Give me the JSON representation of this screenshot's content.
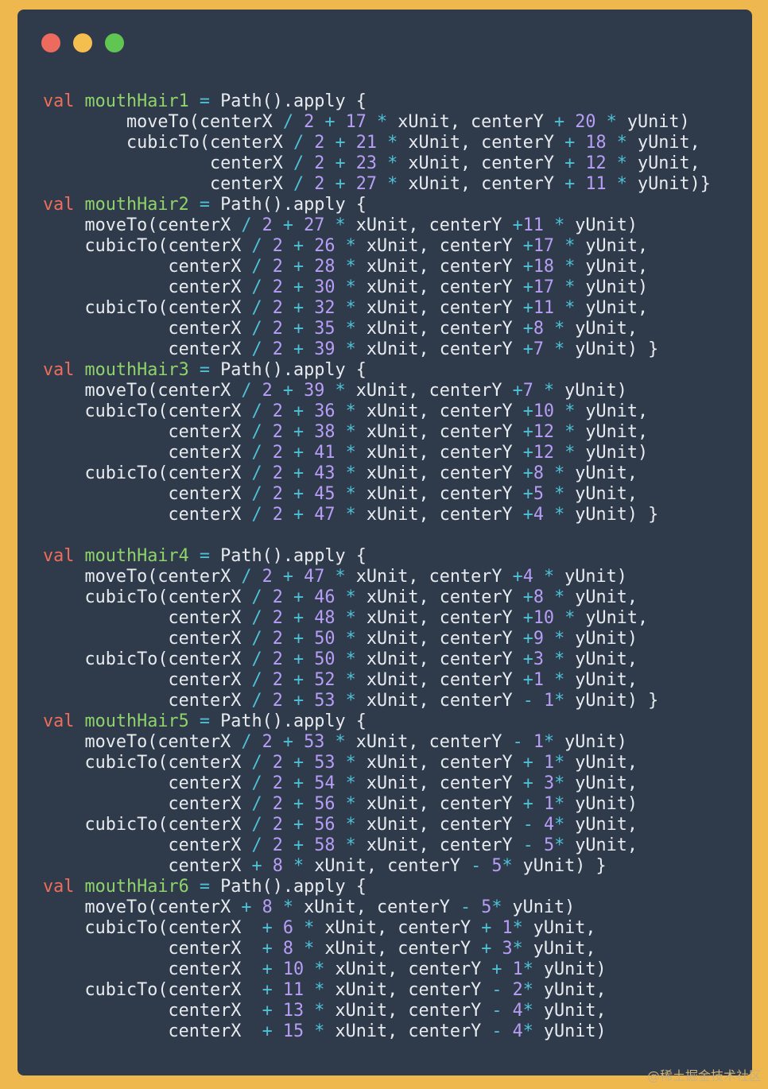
{
  "window": {
    "controls": [
      {
        "name": "close",
        "color": "#ed6a5e"
      },
      {
        "name": "minimize",
        "color": "#f5bf4f"
      },
      {
        "name": "maximize",
        "color": "#61c554"
      }
    ]
  },
  "colors": {
    "background": "#eeb84e",
    "editor": "#2f3a4b",
    "keyword": "#ef6e5b",
    "identifier": "#8fd36b",
    "number": "#b89ef5",
    "operator": "#4fc1d6",
    "text": "#e8ebef"
  },
  "code_lines": [
    "val mouthHair1 = Path().apply {",
    "        moveTo(centerX / 2 + 17 * xUnit, centerY + 20 * yUnit)",
    "        cubicTo(centerX / 2 + 21 * xUnit, centerY + 18 * yUnit,",
    "                centerX / 2 + 23 * xUnit, centerY + 12 * yUnit,",
    "                centerX / 2 + 27 * xUnit, centerY + 11 * yUnit)}",
    "val mouthHair2 = Path().apply {",
    "    moveTo(centerX / 2 + 27 * xUnit, centerY +11 * yUnit)",
    "    cubicTo(centerX / 2 + 26 * xUnit, centerY +17 * yUnit,",
    "            centerX / 2 + 28 * xUnit, centerY +18 * yUnit,",
    "            centerX / 2 + 30 * xUnit, centerY +17 * yUnit)",
    "    cubicTo(centerX / 2 + 32 * xUnit, centerY +11 * yUnit,",
    "            centerX / 2 + 35 * xUnit, centerY +8 * yUnit,",
    "            centerX / 2 + 39 * xUnit, centerY +7 * yUnit) }",
    "val mouthHair3 = Path().apply {",
    "    moveTo(centerX / 2 + 39 * xUnit, centerY +7 * yUnit)",
    "    cubicTo(centerX / 2 + 36 * xUnit, centerY +10 * yUnit,",
    "            centerX / 2 + 38 * xUnit, centerY +12 * yUnit,",
    "            centerX / 2 + 41 * xUnit, centerY +12 * yUnit)",
    "    cubicTo(centerX / 2 + 43 * xUnit, centerY +8 * yUnit,",
    "            centerX / 2 + 45 * xUnit, centerY +5 * yUnit,",
    "            centerX / 2 + 47 * xUnit, centerY +4 * yUnit) }",
    "",
    "val mouthHair4 = Path().apply {",
    "    moveTo(centerX / 2 + 47 * xUnit, centerY +4 * yUnit)",
    "    cubicTo(centerX / 2 + 46 * xUnit, centerY +8 * yUnit,",
    "            centerX / 2 + 48 * xUnit, centerY +10 * yUnit,",
    "            centerX / 2 + 50 * xUnit, centerY +9 * yUnit)",
    "    cubicTo(centerX / 2 + 50 * xUnit, centerY +3 * yUnit,",
    "            centerX / 2 + 52 * xUnit, centerY +1 * yUnit,",
    "            centerX / 2 + 53 * xUnit, centerY - 1* yUnit) }",
    "val mouthHair5 = Path().apply {",
    "    moveTo(centerX / 2 + 53 * xUnit, centerY - 1* yUnit)",
    "    cubicTo(centerX / 2 + 53 * xUnit, centerY + 1* yUnit,",
    "            centerX / 2 + 54 * xUnit, centerY + 3* yUnit,",
    "            centerX / 2 + 56 * xUnit, centerY + 1* yUnit)",
    "    cubicTo(centerX / 2 + 56 * xUnit, centerY - 4* yUnit,",
    "            centerX / 2 + 58 * xUnit, centerY - 5* yUnit,",
    "            centerX + 8 * xUnit, centerY - 5* yUnit) }",
    "val mouthHair6 = Path().apply {",
    "    moveTo(centerX + 8 * xUnit, centerY - 5* yUnit)",
    "    cubicTo(centerX  + 6 * xUnit, centerY + 1* yUnit,",
    "            centerX  + 8 * xUnit, centerY + 3* yUnit,",
    "            centerX  + 10 * xUnit, centerY + 1* yUnit)",
    "    cubicTo(centerX  + 11 * xUnit, centerY - 2* yUnit,",
    "            centerX  + 13 * xUnit, centerY - 4* yUnit,",
    "            centerX  + 15 * xUnit, centerY - 4* yUnit)"
  ],
  "watermark": "@稀土掘金技术社区"
}
